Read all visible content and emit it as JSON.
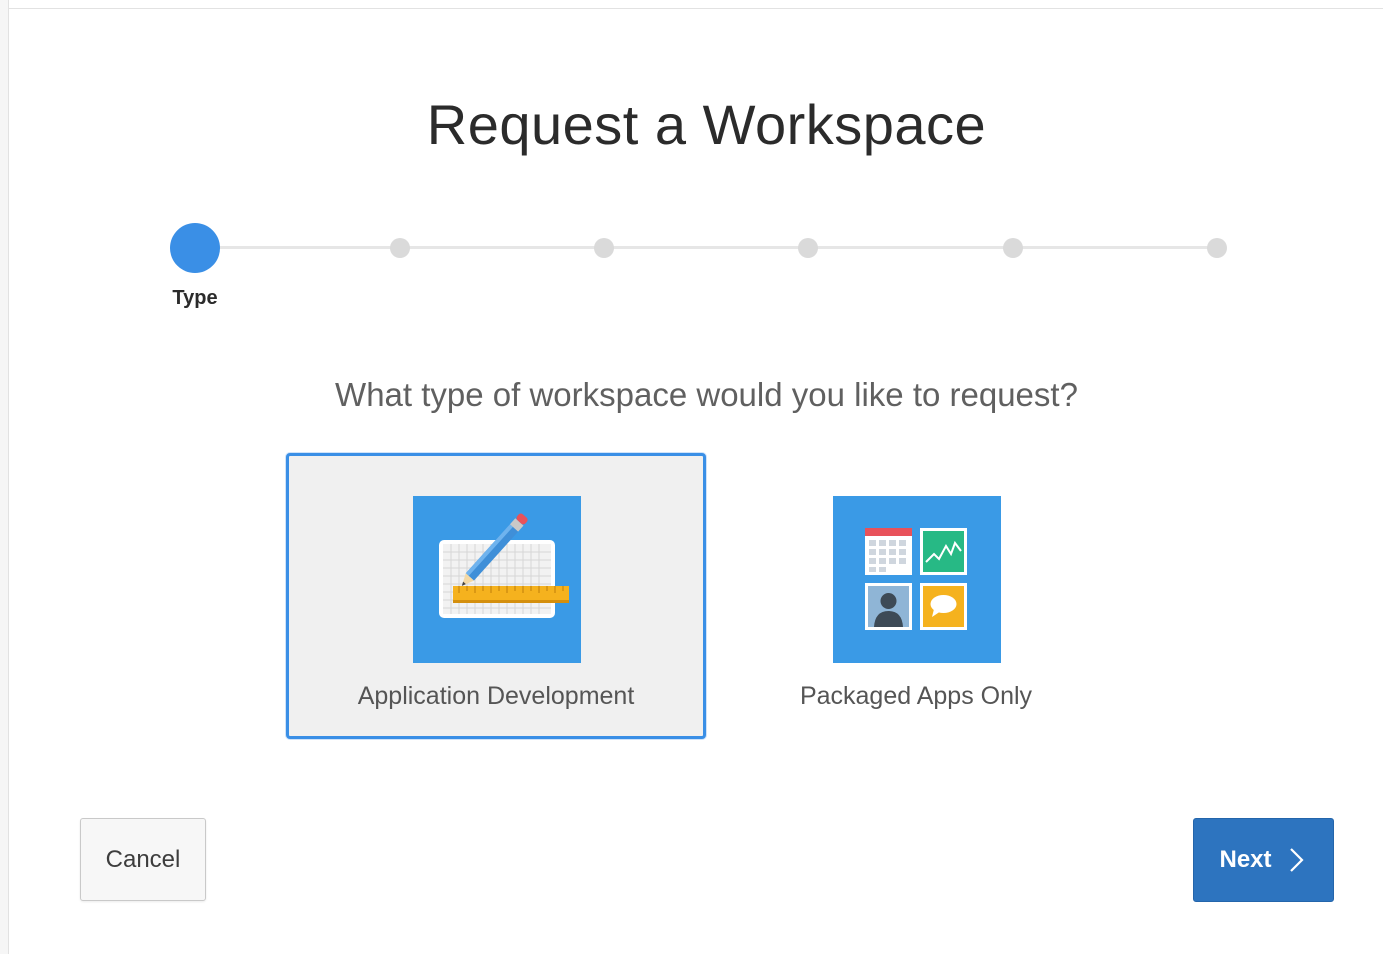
{
  "page": {
    "title": "Request a Workspace",
    "question": "What type of workspace would you like to request?"
  },
  "wizard": {
    "current_step_label": "Type",
    "total_steps": 6,
    "current_step": 1
  },
  "options": [
    {
      "label": "Application Development",
      "icon": "ruler-pencil-grid-icon",
      "selected": true
    },
    {
      "label": "Packaged Apps Only",
      "icon": "app-tiles-icon",
      "selected": false
    }
  ],
  "buttons": {
    "cancel_label": "Cancel",
    "next_label": "Next",
    "next_icon": "chevron-right-icon"
  },
  "colors": {
    "accent": "#3a8fe6",
    "icon_tile": "#3a9ae6",
    "primary_button": "#2d74bf",
    "selected_card_bg": "#f0f0f0"
  }
}
